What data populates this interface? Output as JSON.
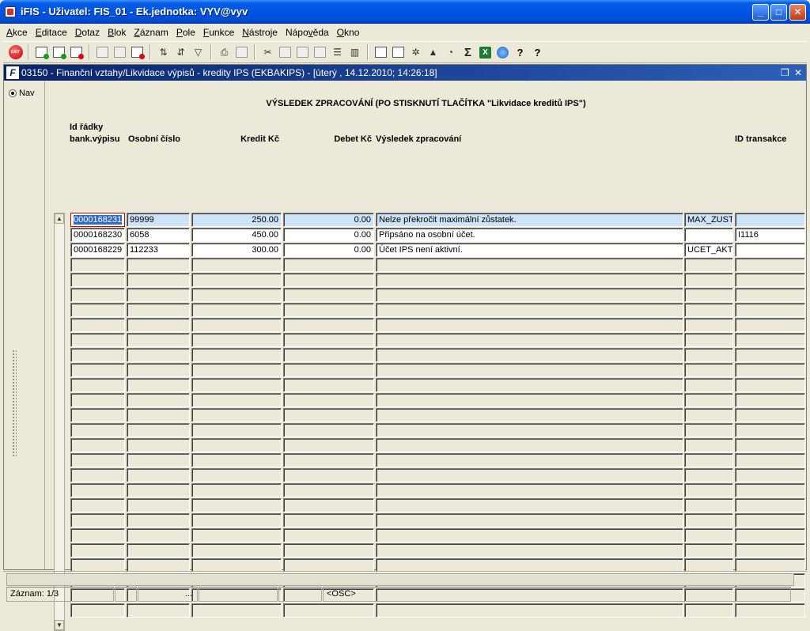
{
  "window": {
    "title": "iFIS - Uživatel: FIS_01 - Ek.jednotka: VYV@vyv"
  },
  "menu": [
    {
      "label": "Akce",
      "u": "A",
      "rest": "kce"
    },
    {
      "label": "Editace",
      "u": "E",
      "rest": "ditace"
    },
    {
      "label": "Dotaz",
      "u": "D",
      "rest": "otaz"
    },
    {
      "label": "Blok",
      "u": "B",
      "rest": "lok"
    },
    {
      "label": "Záznam",
      "u": "Z",
      "rest": "áznam"
    },
    {
      "label": "Pole",
      "u": "P",
      "rest": "ole"
    },
    {
      "label": "Funkce",
      "u": "F",
      "rest": "unkce"
    },
    {
      "label": "Nástroje",
      "u": "N",
      "rest": "ástroje"
    },
    {
      "label": "Nápověda",
      "pre": "Nápo",
      "u": "v",
      "rest": "ěda"
    },
    {
      "label": "Okno",
      "u": "O",
      "rest": "kno"
    }
  ],
  "toolbar": {
    "exit_label": "EXIT",
    "excel_label": "X",
    "sum_label": "Σ",
    "help_label": "?"
  },
  "form": {
    "title": "03150 - Finanční vztahy/Likvidace výpisů - kredity IPS (EKBAKIPS) - [úterý  , 14.12.2010; 14:26:18]",
    "nav_label": "Nav",
    "heading": "VÝSLEDEK ZPRACOVÁNÍ (PO STISKNUTÍ TLAČÍTKA \"Likvidace kreditů IPS\")"
  },
  "columns": {
    "id_line1": "Id řádky",
    "id_line2": "bank.výpisu",
    "osobni": "Osobní číslo",
    "kredit": "Kredit Kč",
    "debet": "Debet Kč",
    "vysledek": "Výsledek zpracování",
    "transakce": "ID transakce"
  },
  "rows": [
    {
      "id": "0000168231",
      "osobni": "99999",
      "kredit": "250.00",
      "debet": "0.00",
      "vysledek": "Nelze překročit maximální zůstatek.",
      "kod": "MAX_ZUST",
      "transakce": ""
    },
    {
      "id": "0000168230",
      "osobni": "6058",
      "kredit": "450.00",
      "debet": "0.00",
      "vysledek": "Připsáno na osobní účet.",
      "kod": "",
      "transakce": "I1116"
    },
    {
      "id": "0000168229",
      "osobni": "112233",
      "kredit": "300.00",
      "debet": "0.00",
      "vysledek": "Účet IPS není aktivní.",
      "kod": "UCET_AKT",
      "transakce": ""
    }
  ],
  "status": {
    "record": "Záznam: 1/3",
    "dots": "...",
    "mode": "<OSC>"
  }
}
